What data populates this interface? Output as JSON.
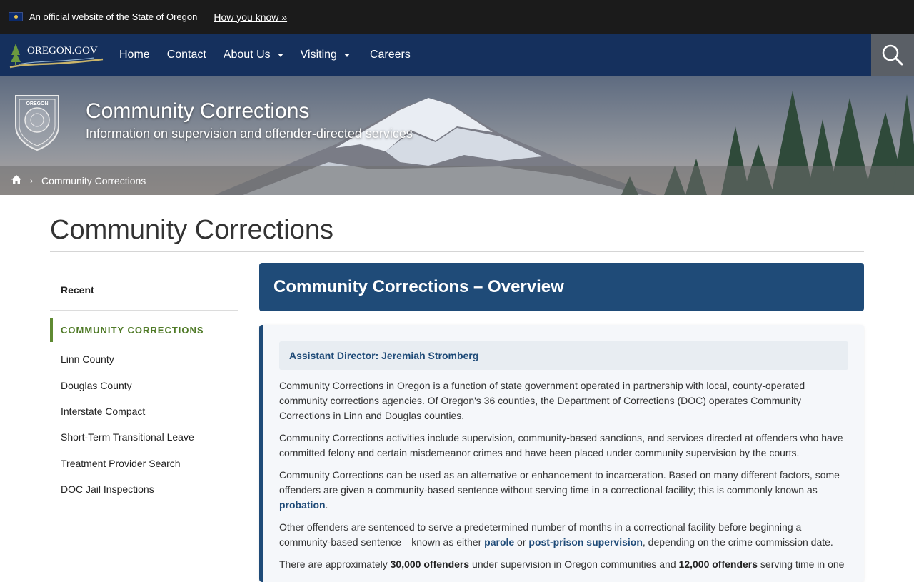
{
  "banner": {
    "official_text": "An official website of the State of Oregon",
    "how_you_know": "How you know »",
    "flag_icon": "oregon-flag-icon"
  },
  "nav": {
    "logo_text": "OREGON.GOV",
    "items": [
      {
        "label": "Home"
      },
      {
        "label": "Contact"
      },
      {
        "label": "About Us"
      },
      {
        "label": "Visiting"
      },
      {
        "label": "Careers"
      }
    ],
    "search_icon": "search-icon"
  },
  "hero": {
    "title": "Community Corrections",
    "subtitle": "Information on supervision and offender-directed services",
    "seal_top_text": "OREGON",
    "seal_side_text": "DEPARTMENT OF CORRECTIONS",
    "breadcrumb": {
      "home_icon": "home-icon",
      "current": "Community Corrections"
    }
  },
  "page": {
    "title": "Community Corrections"
  },
  "sidebar": {
    "recent": "Recent",
    "active": "COMMUNITY CORRECTIONS",
    "links": [
      "Linn County",
      "Douglas County",
      "Interstate Compact",
      "Short-Term Transitional Leave",
      "Treatment Provider Search",
      "DOC Jail Inspections"
    ]
  },
  "main": {
    "header": "Community Corrections – Overview",
    "director": "Assistant Director: Jeremiah Stromberg",
    "p1": "Community Corrections in Oregon is a function of state government operated in partnership with local, county-operated community corrections agencies. Of Oregon's 36 counties, the Department of Corrections (DOC) operates Community Corrections in Linn and Douglas counties.",
    "p2": "Community Corrections activities include supervision, community-based sanctions, and services directed at offenders who have committed felony and certain misdemeanor crimes and have been placed under community supervision by the courts.",
    "p3_text": "Community Corrections can be used as an alternative or enhancement to incarceration. Based on many different factors, some offenders are given a community-based sentence without serving time in a correctional facility; this is commonly known as ",
    "p3_link": "probation",
    "p3_end": ".",
    "p4_text": "Other offenders are sentenced to serve a predetermined number of months in a correctional facility before beginning a community-based sentence—known as either ",
    "p4_link1": "parole",
    "p4_mid": " or ",
    "p4_link2": "post-prison supervision",
    "p4_end": ", depending on the crime commission date.",
    "p5_a": "There are approximately ",
    "p5_b1": "30,000 offenders",
    "p5_c": " under supervision in Oregon communities and ",
    "p5_b2": "12,000 offenders",
    "p5_d": " serving time in one"
  },
  "colors": {
    "nav_bg": "#15305d",
    "accent_blue": "#1f4b78",
    "accent_green": "#5f8a32",
    "banner_bg": "#1b1b1b"
  }
}
